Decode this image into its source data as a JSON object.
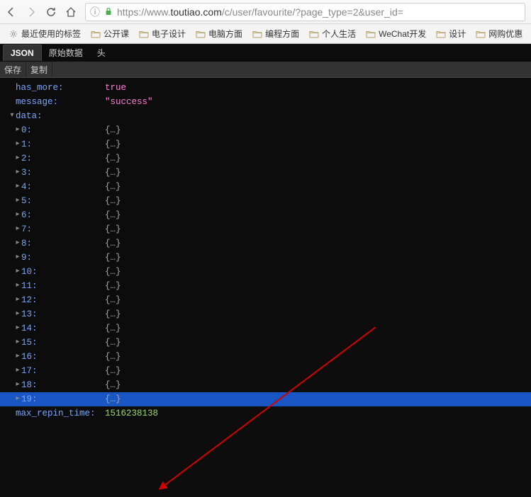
{
  "browser": {
    "url_prefix": "https://www.",
    "url_domain": "toutiao.com",
    "url_rest": "/c/user/favourite/?page_type=2&user_id="
  },
  "bookmarks": [
    {
      "icon": "gear",
      "label": "最近使用的标签"
    },
    {
      "icon": "folder",
      "label": "公开课"
    },
    {
      "icon": "folder",
      "label": "电子设计"
    },
    {
      "icon": "folder",
      "label": "电脑方面"
    },
    {
      "icon": "folder",
      "label": "编程方面"
    },
    {
      "icon": "folder",
      "label": "个人生活"
    },
    {
      "icon": "folder",
      "label": "WeChat开发"
    },
    {
      "icon": "folder",
      "label": "设计"
    },
    {
      "icon": "folder",
      "label": "网购优惠"
    }
  ],
  "tabs": [
    {
      "label": "JSON",
      "active": true
    },
    {
      "label": "原始数据",
      "active": false
    },
    {
      "label": "头",
      "active": false
    }
  ],
  "controls": [
    {
      "label": "保存"
    },
    {
      "label": "复制"
    }
  ],
  "json": {
    "has_more_key": "has_more:",
    "has_more_val": "true",
    "message_key": "message:",
    "message_val": "\"success\"",
    "data_key": "data:",
    "items": [
      {
        "key": "0:",
        "val": "{…}"
      },
      {
        "key": "1:",
        "val": "{…}"
      },
      {
        "key": "2:",
        "val": "{…}"
      },
      {
        "key": "3:",
        "val": "{…}"
      },
      {
        "key": "4:",
        "val": "{…}"
      },
      {
        "key": "5:",
        "val": "{…}"
      },
      {
        "key": "6:",
        "val": "{…}"
      },
      {
        "key": "7:",
        "val": "{…}"
      },
      {
        "key": "8:",
        "val": "{…}"
      },
      {
        "key": "9:",
        "val": "{…}"
      },
      {
        "key": "10:",
        "val": "{…}"
      },
      {
        "key": "11:",
        "val": "{…}"
      },
      {
        "key": "12:",
        "val": "{…}"
      },
      {
        "key": "13:",
        "val": "{…}"
      },
      {
        "key": "14:",
        "val": "{…}"
      },
      {
        "key": "15:",
        "val": "{…}"
      },
      {
        "key": "16:",
        "val": "{…}"
      },
      {
        "key": "17:",
        "val": "{…}"
      },
      {
        "key": "18:",
        "val": "{…}"
      },
      {
        "key": "19:",
        "val": "{…}",
        "selected": true
      }
    ],
    "max_repin_time_key": "max_repin_time:",
    "max_repin_time_val": "1516238138"
  },
  "colors": {
    "selected_row": "#1a56c3",
    "key": "#7aa8ff",
    "val_special": "#ff7fd6",
    "val_num": "#9bdb6d",
    "val_obj": "#aaaaaa"
  }
}
